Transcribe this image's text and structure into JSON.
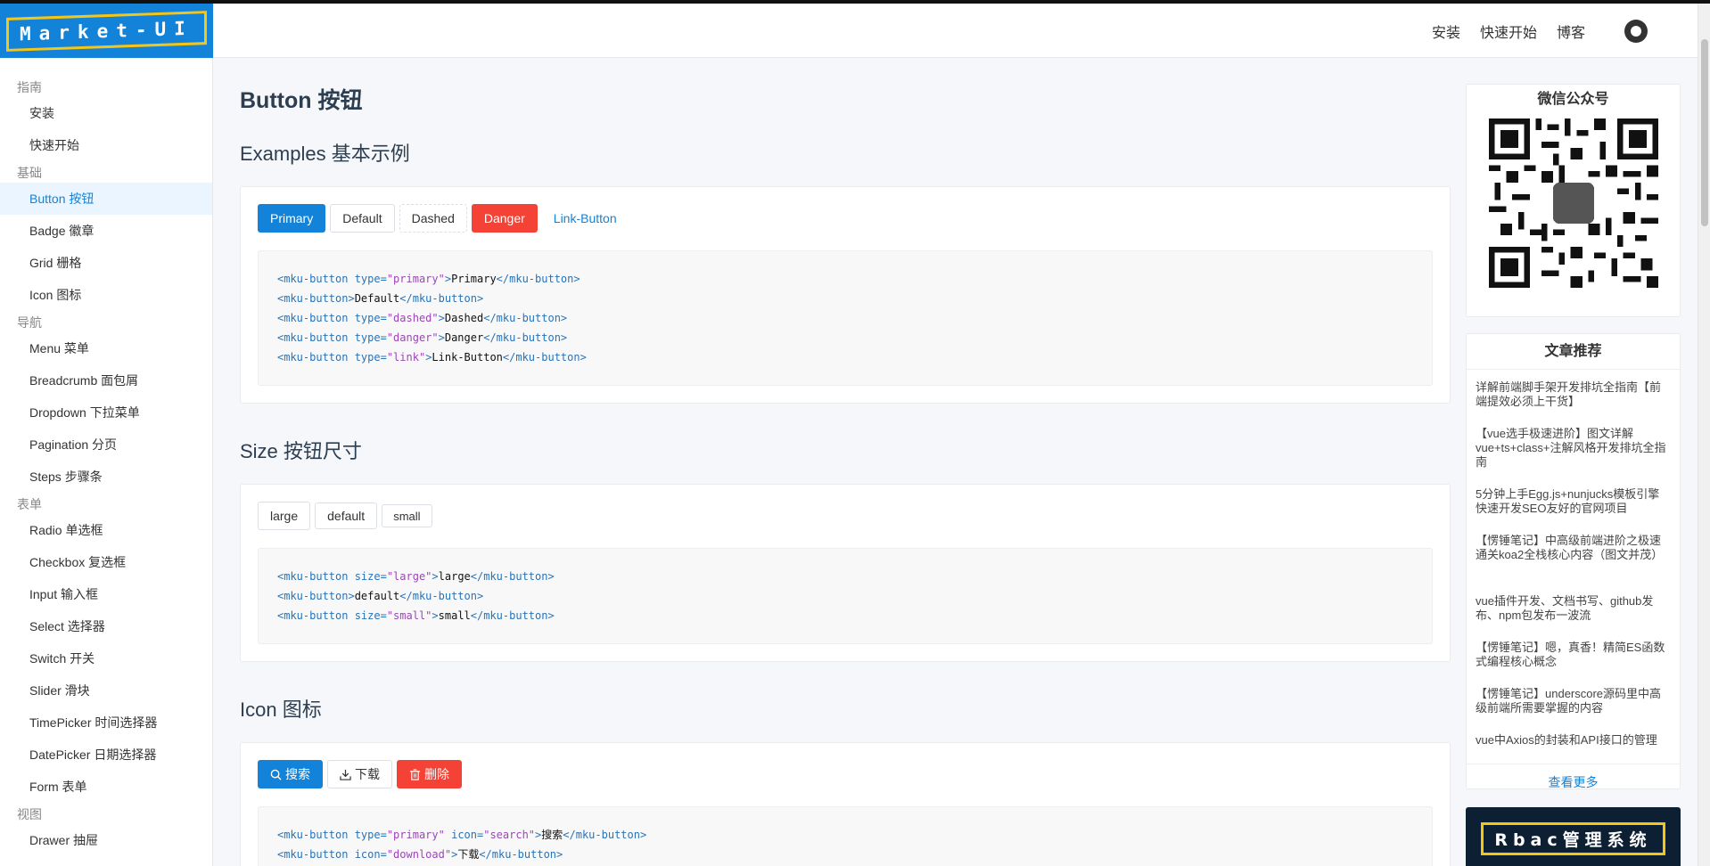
{
  "header": {
    "logo": "Market-UI",
    "nav": [
      "安装",
      "快速开始",
      "博客"
    ]
  },
  "sidebar": {
    "groups": [
      {
        "title": "指南",
        "items": [
          "安装",
          "快速开始"
        ]
      },
      {
        "title": "基础",
        "items": [
          "Button 按钮",
          "Badge 徽章",
          "Grid 栅格",
          "Icon 图标"
        ]
      },
      {
        "title": "导航",
        "items": [
          "Menu 菜单",
          "Breadcrumb 面包屑",
          "Dropdown 下拉菜单",
          "Pagination 分页",
          "Steps 步骤条"
        ]
      },
      {
        "title": "表单",
        "items": [
          "Radio 单选框",
          "Checkbox 复选框",
          "Input 输入框",
          "Select 选择器",
          "Switch 开关",
          "Slider 滑块",
          "TimePicker 时间选择器",
          "DatePicker 日期选择器",
          "Form 表单"
        ]
      },
      {
        "title": "视图",
        "items": [
          "Drawer 抽屉"
        ]
      }
    ],
    "active": "Button 按钮"
  },
  "main": {
    "title": "Button 按钮",
    "sections": [
      {
        "title": "Examples 基本示例",
        "buttons": [
          "Primary",
          "Default",
          "Dashed",
          "Danger",
          "Link-Button"
        ]
      },
      {
        "title": "Size 按钮尺寸",
        "buttons": [
          "large",
          "default",
          "small"
        ]
      },
      {
        "title": "Icon 图标",
        "buttons": [
          "搜索",
          "下载",
          "删除"
        ]
      }
    ]
  },
  "aside": {
    "wechat_title": "微信公众号",
    "rec_title": "文章推荐",
    "articles": [
      "详解前端脚手架开发排坑全指南【前端提效必须上干货】",
      "【vue选手极速进阶】图文详解vue+ts+class+注解风格开发排坑全指南",
      "5分钟上手Egg.js+nunjucks模板引擎快速开发SEO友好的官网项目",
      "【愣锤笔记】中高级前端进阶之极速通关koa2全栈核心内容（图文并茂）",
      "vue插件开发、文档书写、github发布、npm包发布一波流",
      "【愣锤笔记】嗯，真香！精简ES函数式编程核心概念",
      "【愣锤笔记】underscore源码里中高级前端所需要掌握的内容",
      "vue中Axios的封装和API接口的管理"
    ],
    "more": "查看更多",
    "banner": "Rbac管理系统"
  },
  "colors": {
    "primary": "#1383d9",
    "danger": "#f44336"
  }
}
